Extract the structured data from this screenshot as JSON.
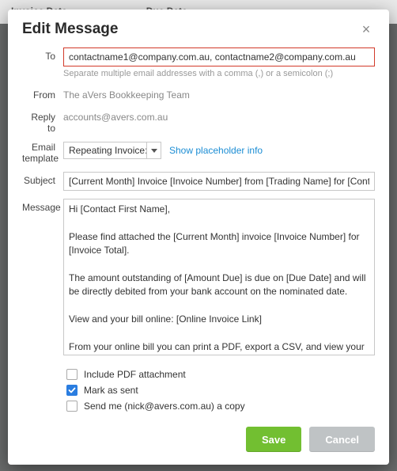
{
  "background": {
    "col1": "Invoice Date",
    "col2": "Due Date"
  },
  "modal": {
    "title": "Edit Message",
    "close_icon": "×"
  },
  "fields": {
    "to": {
      "label": "To",
      "value": "contactname1@company.com.au, contactname2@company.com.au",
      "hint": "Separate multiple email addresses with a comma (,) or a semicolon (;)"
    },
    "from": {
      "label": "From",
      "value": "The aVers Bookkeeping Team"
    },
    "reply_to": {
      "label": "Reply to",
      "value": "accounts@avers.com.au"
    },
    "template": {
      "label": "Email template",
      "selected": "Repeating Invoice: Pa",
      "link": "Show placeholder info"
    },
    "subject": {
      "label": "Subject",
      "value": "[Current Month] Invoice [Invoice Number] from [Trading Name] for [Cont"
    },
    "message": {
      "label": "Message",
      "value": "Hi [Contact First Name],\n\nPlease find attached the [Current Month] invoice [Invoice Number] for [Invoice Total].\n\nThe amount outstanding of [Amount Due] is due on [Due Date] and will be directly debited from your bank account on the nominated date.\n\nView and your bill online: [Online Invoice Link]\n\nFrom your online bill you can print a PDF, export a CSV, and view your outstanding bills.\n\nIf you have any questions, please let us know.\n\nKind Regards,"
    }
  },
  "checkboxes": {
    "include_pdf": {
      "label": "Include PDF attachment",
      "checked": false
    },
    "mark_sent": {
      "label": "Mark as sent",
      "checked": true
    },
    "send_copy": {
      "label": "Send me (nick@avers.com.au) a copy",
      "checked": false
    }
  },
  "buttons": {
    "save": "Save",
    "cancel": "Cancel"
  }
}
